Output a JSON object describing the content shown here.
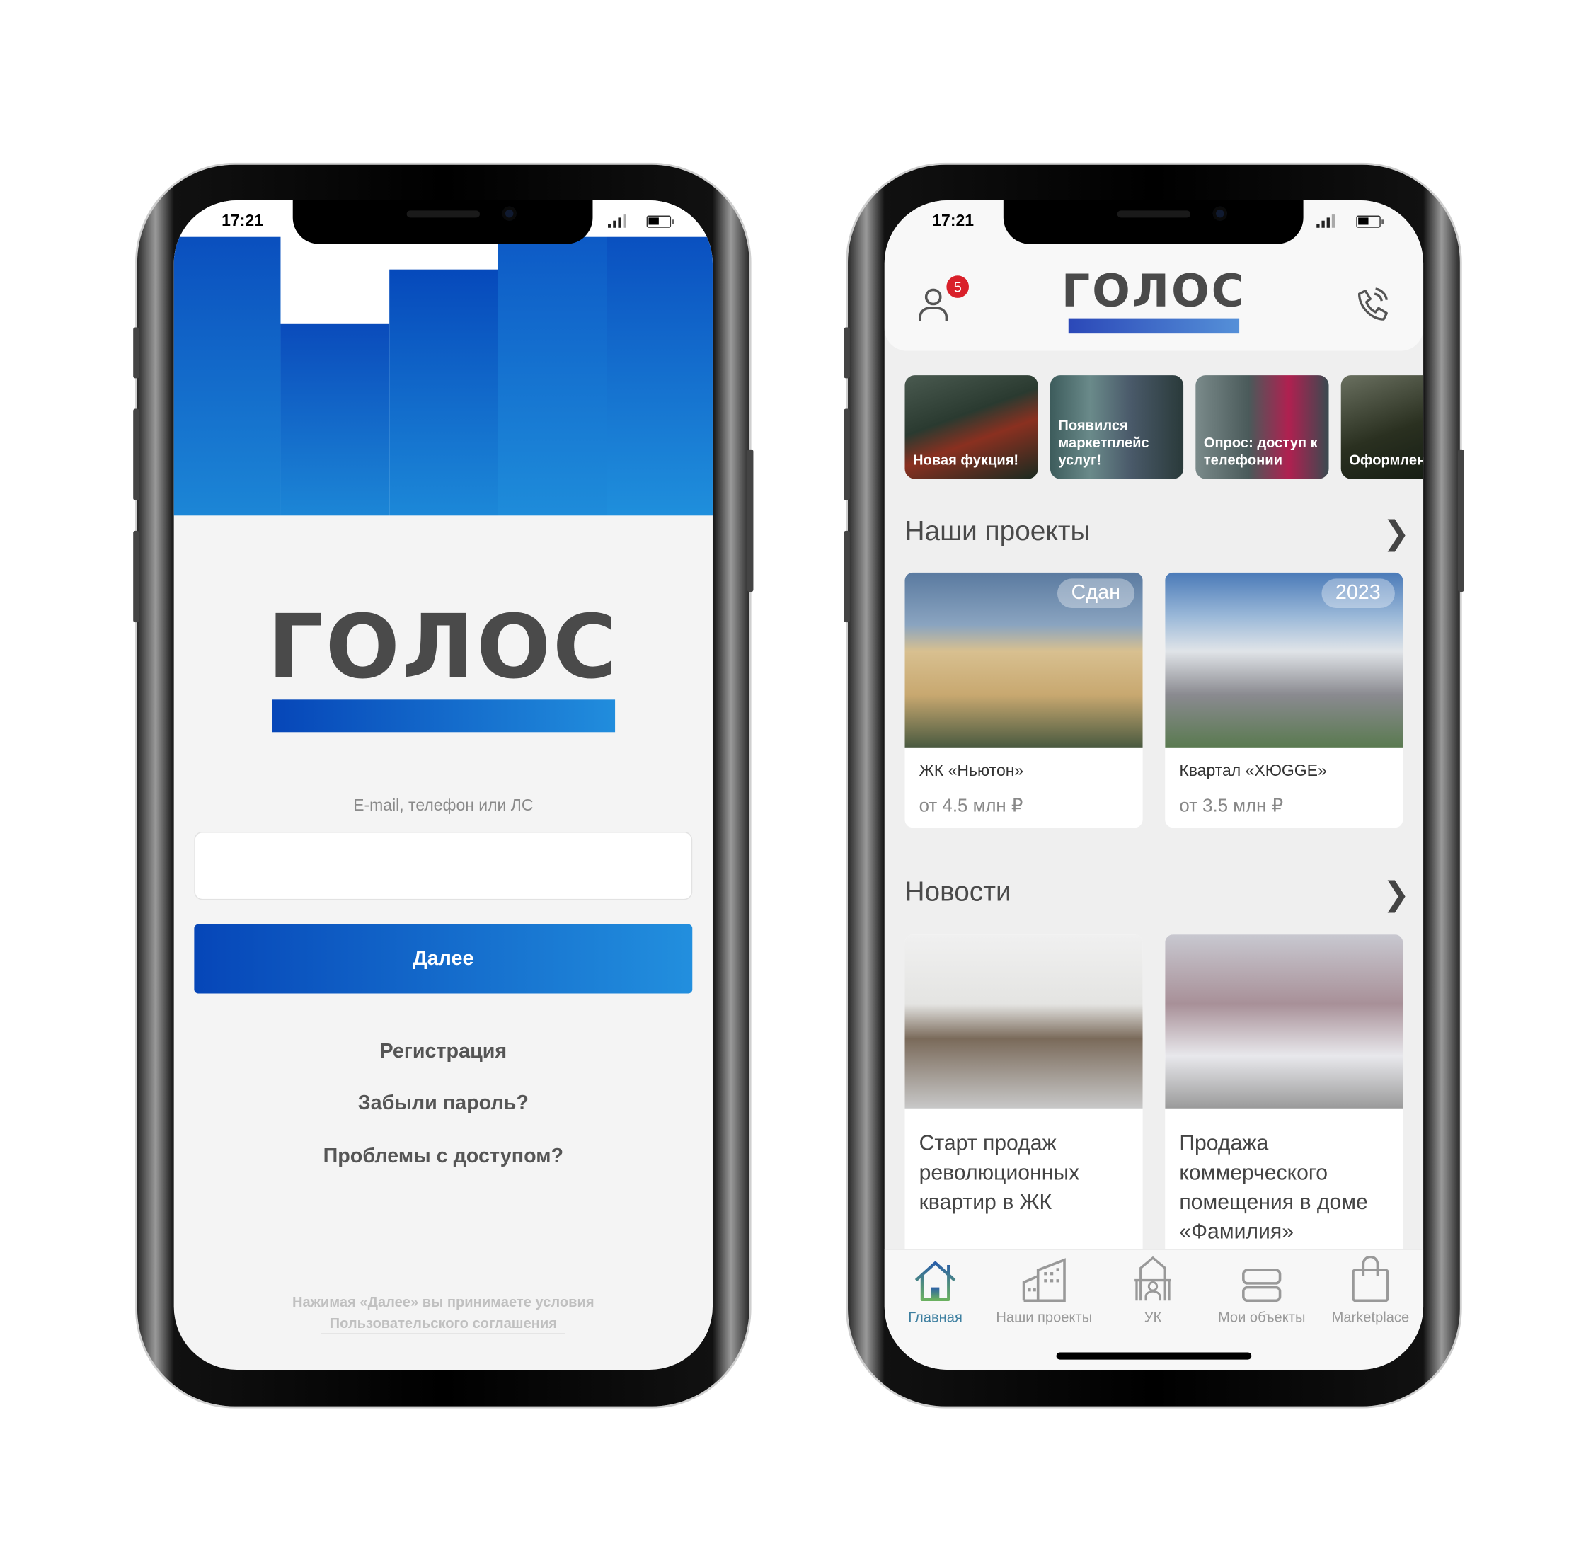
{
  "status_bar": {
    "time": "17:21"
  },
  "login": {
    "logo": "ГОЛОС",
    "field_label": "E-mail, телефон или ЛС",
    "field_value": "",
    "next_button": "Далее",
    "links": [
      "Регистрация",
      "Забыли пароль?",
      "Проблемы с доступом?"
    ],
    "terms_line1": "Нажимая «Далее» вы принимаете условия",
    "terms_link": "Пользовательского соглашения"
  },
  "home": {
    "logo": "ГОЛОС",
    "notification_count": "5",
    "icons": {
      "profile": "user-icon",
      "call": "phone-call-icon"
    },
    "stories": [
      "Новая фукция!",
      "Появился маркетплейс услуг!",
      "Опрос: доступ к телефонии",
      "Оформление парадных"
    ],
    "projects_title": "Наши проекты",
    "projects": [
      {
        "badge": "Сдан",
        "name": "ЖК «Ньютон»",
        "price": "от 4.5 млн ₽"
      },
      {
        "badge": "2023",
        "name": "Квартал «ХЮGGE»",
        "price": "от 3.5 млн ₽"
      }
    ],
    "news_title": "Новости",
    "news": [
      {
        "title": "Старт продаж революционных квартир в ЖК"
      },
      {
        "title": "Продажа коммерческого помещения в доме «Фамилия»"
      }
    ],
    "tabs": [
      {
        "label": "Главная",
        "icon": "home-icon",
        "active": true
      },
      {
        "label": "Наши проекты",
        "icon": "buildings-icon"
      },
      {
        "label": "УК",
        "icon": "management-company-icon"
      },
      {
        "label": "Мои объекты",
        "icon": "my-objects-icon"
      },
      {
        "label": "Marketplace",
        "icon": "shopping-bag-icon"
      }
    ]
  },
  "colors": {
    "brand_blue": "#0a4fc0",
    "brand_blue_light": "#2190de",
    "badge_red": "#d9202a",
    "text_dark": "#4a4a4a",
    "active_tab": "#3d7fa0"
  }
}
